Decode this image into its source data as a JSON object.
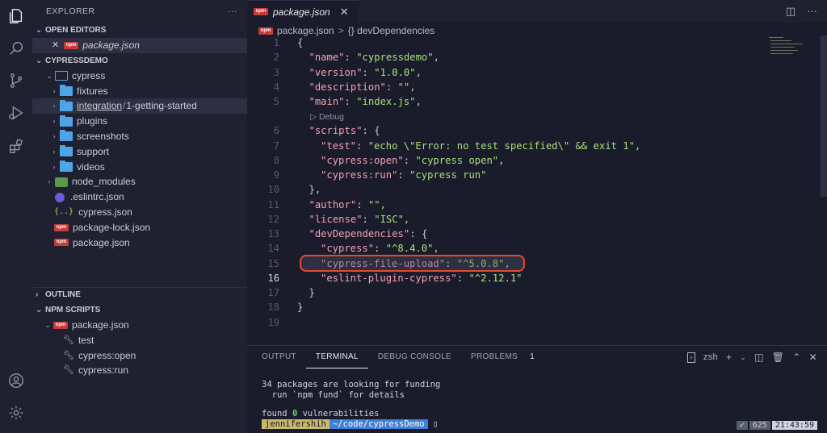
{
  "activity": [
    "explorer-icon",
    "search-icon",
    "source-control-icon",
    "run-debug-icon",
    "extensions-icon",
    "account-icon",
    "settings-icon"
  ],
  "sidebar": {
    "title": "EXPLORER",
    "more": "···",
    "open_editors": {
      "title": "OPEN EDITORS",
      "items": [
        {
          "close": "✕",
          "badge": "npm",
          "label": "package.json"
        }
      ]
    },
    "project": {
      "title": "CYPRESSDEMO",
      "tree": {
        "cypress": "cypress",
        "fixtures": "fixtures",
        "integration": "integration",
        "integration_sub": "1-getting-started",
        "plugins": "plugins",
        "screenshots": "screenshots",
        "support": "support",
        "videos": "videos",
        "node_modules": "node_modules",
        "eslintrc": ".eslintrc.json",
        "cypress_json": "cypress.json",
        "package_lock": "package-lock.json",
        "package_json": "package.json"
      }
    },
    "outline": "OUTLINE",
    "npm_scripts": {
      "title": "NPM SCRIPTS",
      "file": "package.json",
      "scripts": [
        "test",
        "cypress:open",
        "cypress:run"
      ]
    }
  },
  "editor": {
    "tab": {
      "badge": "npm",
      "label": "package.json",
      "close": "✕"
    },
    "breadcrumb": {
      "file": "package.json",
      "sep": ">",
      "symbol": "{} devDependencies"
    },
    "codelens": "▷ Debug",
    "current_line": 16,
    "lines": [
      {
        "n": "1",
        "t": "{"
      },
      {
        "n": "2",
        "k": "\"name\"",
        "v": "\"cypressdemo\","
      },
      {
        "n": "3",
        "k": "\"version\"",
        "v": "\"1.0.0\","
      },
      {
        "n": "4",
        "k": "\"description\"",
        "v": "\"\","
      },
      {
        "n": "5",
        "k": "\"main\"",
        "v": "\"index.js\","
      },
      {
        "n": "6",
        "k": "\"scripts\"",
        "t2": "{"
      },
      {
        "n": "7",
        "k": "\"test\"",
        "v": "\"echo \\\"Error: no test specified\\\" && exit 1\","
      },
      {
        "n": "8",
        "k": "\"cypress:open\"",
        "v": "\"cypress open\","
      },
      {
        "n": "9",
        "k": "\"cypress:run\"",
        "v": "\"cypress run\""
      },
      {
        "n": "10",
        "t": "},"
      },
      {
        "n": "11",
        "k": "\"author\"",
        "v": "\"\","
      },
      {
        "n": "12",
        "k": "\"license\"",
        "v": "\"ISC\","
      },
      {
        "n": "13",
        "k": "\"devDependencies\"",
        "t2": "{"
      },
      {
        "n": "14",
        "k": "\"cypress\"",
        "v": "\"^8.4.0\","
      },
      {
        "n": "15",
        "k": "\"cypress-file-upload\"",
        "v": "\"^5.0.8\","
      },
      {
        "n": "16",
        "k": "\"eslint-plugin-cypress\"",
        "v": "\"^2.12.1\""
      },
      {
        "n": "17",
        "t": "}"
      },
      {
        "n": "18",
        "t": "}"
      },
      {
        "n": "19",
        "t": ""
      }
    ]
  },
  "panel": {
    "tabs": [
      "OUTPUT",
      "TERMINAL",
      "DEBUG CONSOLE",
      "PROBLEMS"
    ],
    "problems_count": "1",
    "shell": "zsh",
    "terminal": {
      "line1": "34 packages are looking for funding",
      "line2": "  run `npm fund` for details",
      "found": "found ",
      "vuln_count": "0",
      "vuln_text": " vulnerabilities",
      "user": "jennifershih",
      "path": "~/code/cypressDemo",
      "rp_check": "✔",
      "rp_num": "625",
      "rp_time": "21:43:59"
    }
  },
  "colors": {
    "accent": "#4fa3e8",
    "highlight": "#e8492c",
    "key": "#f2a0b6",
    "string": "#a6e07b"
  }
}
